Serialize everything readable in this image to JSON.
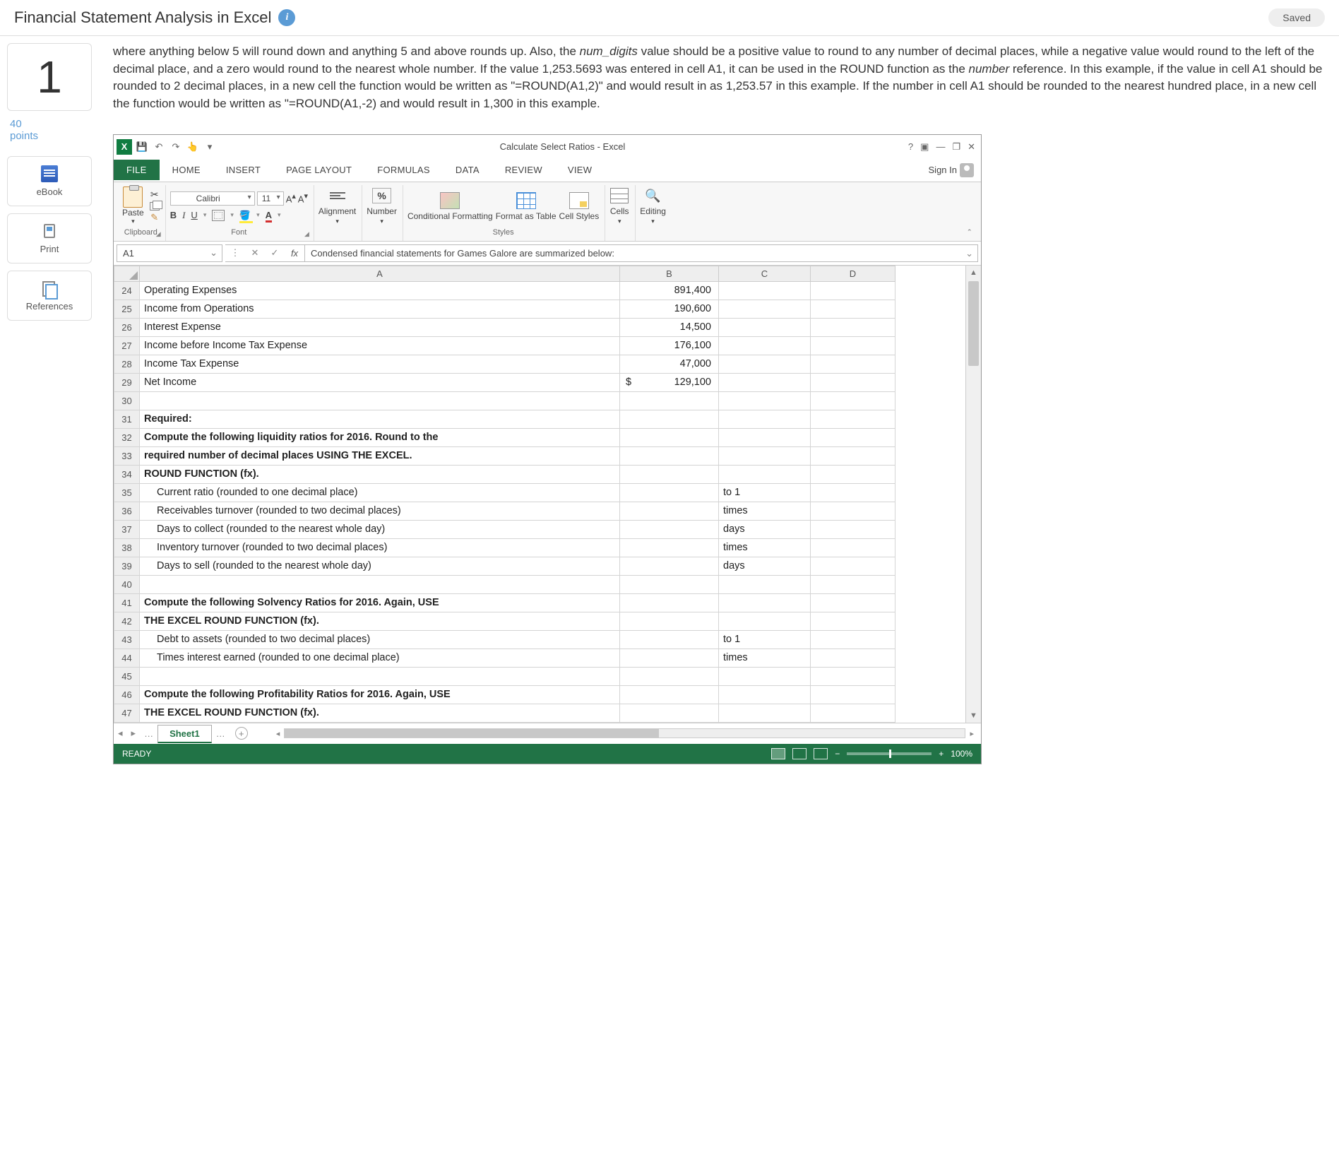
{
  "header": {
    "title": "Financial Statement Analysis in Excel",
    "saved": "Saved"
  },
  "question": {
    "number": "1",
    "points_value": "40",
    "points_label": "points"
  },
  "tools": {
    "ebook": "eBook",
    "print": "Print",
    "references": "References"
  },
  "intro": {
    "p1a": "where anything below 5 will round down and anything 5 and above rounds up.  Also, the ",
    "p1b": "num_digits",
    "p1c": " value should be a positive value to round to any number of decimal places, while a negative value would round to the left of the decimal place, and a zero would round to the nearest whole number.  If the value 1,253.5693 was entered in cell A1, it can be used in the ROUND function as the ",
    "p1d": "number",
    "p1e": " reference.  In this example, if the value in cell A1 should be rounded to 2 decimal places, in a new cell the function would be written as \"=ROUND(A1,2)\" and would result in as 1,253.57 in this example.  If the number in cell A1 should be rounded to the nearest hundred place, in a new cell the function would be written as \"=ROUND(A1,-2) and would result in 1,300 in this example."
  },
  "excel": {
    "titlebar": "Calculate Select Ratios - Excel",
    "signin": "Sign In",
    "tabs": {
      "file": "FILE",
      "home": "HOME",
      "insert": "INSERT",
      "pagelayout": "PAGE LAYOUT",
      "formulas": "FORMULAS",
      "data": "DATA",
      "review": "REVIEW",
      "view": "VIEW"
    },
    "ribbon": {
      "paste": "Paste",
      "clipboard": "Clipboard",
      "font": "Font",
      "font_name": "Calibri",
      "font_size": "11",
      "alignment": "Alignment",
      "number": "Number",
      "cond": "Conditional Formatting",
      "fmtas": "Format as Table",
      "cellstyles": "Cell Styles",
      "styles": "Styles",
      "cells": "Cells",
      "editing": "Editing"
    },
    "namebox": "A1",
    "formula": "Condensed financial statements for Games Galore are summarized below:",
    "cols": {
      "A": "A",
      "B": "B",
      "C": "C",
      "D": "D"
    },
    "rows": [
      {
        "n": "24",
        "a": "Operating Expenses",
        "b": "891,400",
        "c": "",
        "bold": false
      },
      {
        "n": "25",
        "a": "Income from Operations",
        "b": "190,600",
        "c": "",
        "bold": false
      },
      {
        "n": "26",
        "a": "Interest Expense",
        "b": "14,500",
        "c": "",
        "bold": false
      },
      {
        "n": "27",
        "a": "Income before Income Tax Expense",
        "b": "176,100",
        "c": "",
        "bold": false
      },
      {
        "n": "28",
        "a": "Income Tax Expense",
        "b": "47,000",
        "c": "",
        "bold": false
      },
      {
        "n": "29",
        "a": "Net Income",
        "b": "129,100",
        "c": "",
        "dollar": true
      },
      {
        "n": "30",
        "a": "",
        "b": "",
        "c": ""
      },
      {
        "n": "31",
        "a": "Required:",
        "b": "",
        "c": "",
        "bold": true
      },
      {
        "n": "32",
        "a": "Compute the following liquidity ratios for 2016. Round to the",
        "b": "",
        "c": "",
        "bold": true
      },
      {
        "n": "33",
        "a": "required number of decimal places USING THE EXCEL.",
        "b": "",
        "c": "",
        "bold": true
      },
      {
        "n": "34",
        "a": "ROUND FUNCTION (fx).",
        "b": "",
        "c": "",
        "bold": true
      },
      {
        "n": "35",
        "a": "Current ratio (rounded to one decimal place)",
        "b": "",
        "c": "to 1",
        "indent": true,
        "yellow": true
      },
      {
        "n": "36",
        "a": "Receivables turnover (rounded to two decimal places)",
        "b": "",
        "c": "times",
        "indent": true,
        "yellow": true
      },
      {
        "n": "37",
        "a": "Days to collect (rounded to the nearest whole day)",
        "b": "",
        "c": "days",
        "indent": true,
        "yellow": true
      },
      {
        "n": "38",
        "a": "Inventory turnover (rounded to two decimal places)",
        "b": "",
        "c": "times",
        "indent": true,
        "yellow": true
      },
      {
        "n": "39",
        "a": "Days to sell (rounded to the nearest whole day)",
        "b": "",
        "c": "days",
        "indent": true,
        "yellow": true
      },
      {
        "n": "40",
        "a": "",
        "b": "",
        "c": ""
      },
      {
        "n": "41",
        "a": "Compute the following Solvency Ratios for 2016. Again, USE",
        "b": "",
        "c": "",
        "bold": true
      },
      {
        "n": "42",
        "a": "THE EXCEL ROUND FUNCTION (fx).",
        "b": "",
        "c": "",
        "bold": true
      },
      {
        "n": "43",
        "a": "Debt to assets (rounded to two decimal places)",
        "b": "",
        "c": "to 1",
        "indent": true,
        "yellow": true
      },
      {
        "n": "44",
        "a": "Times interest earned (rounded to one decimal place)",
        "b": "",
        "c": "times",
        "indent": true,
        "yellow": true
      },
      {
        "n": "45",
        "a": "",
        "b": "",
        "c": ""
      },
      {
        "n": "46",
        "a": "Compute the following Profitability Ratios for 2016. Again, USE",
        "b": "",
        "c": "",
        "bold": true
      },
      {
        "n": "47",
        "a": "THE EXCEL ROUND FUNCTION (fx).",
        "b": "",
        "c": "",
        "bold": true
      }
    ],
    "sheet": "Sheet1",
    "status": "READY",
    "zoom": "100%"
  }
}
